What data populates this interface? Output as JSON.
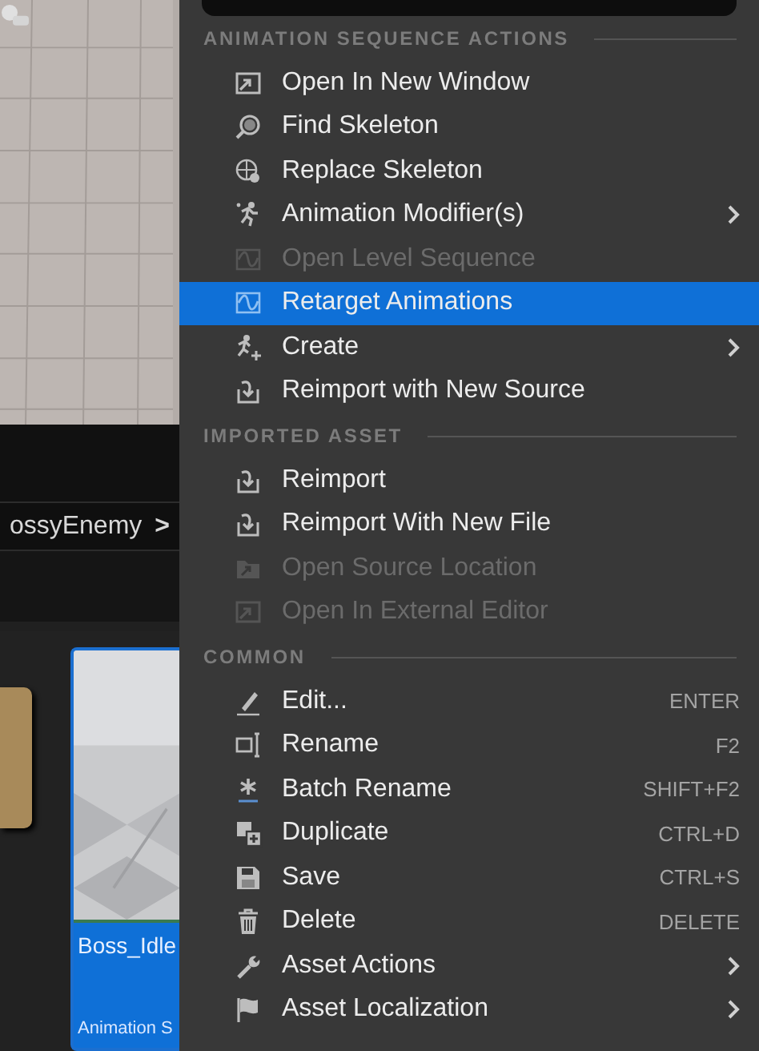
{
  "breadcrumb": {
    "label": "ossyEnemy",
    "chevron": ">"
  },
  "asset_tile": {
    "name": "Boss_Idle",
    "type": "Animation S",
    "selected": true
  },
  "menu": {
    "sections": [
      {
        "title": "ANIMATION SEQUENCE ACTIONS",
        "items": [
          {
            "label": "Open In New Window",
            "disabled": false,
            "selected": false,
            "submenu": false
          },
          {
            "label": "Find Skeleton",
            "disabled": false,
            "selected": false,
            "submenu": false
          },
          {
            "label": "Replace Skeleton",
            "disabled": false,
            "selected": false,
            "submenu": false
          },
          {
            "label": "Animation Modifier(s)",
            "disabled": false,
            "selected": false,
            "submenu": true
          },
          {
            "label": "Open Level Sequence",
            "disabled": true,
            "selected": false,
            "submenu": false
          },
          {
            "label": "Retarget Animations",
            "disabled": false,
            "selected": true,
            "submenu": false
          },
          {
            "label": "Create",
            "disabled": false,
            "selected": false,
            "submenu": true
          },
          {
            "label": "Reimport with New Source",
            "disabled": false,
            "selected": false,
            "submenu": false
          }
        ]
      },
      {
        "title": "IMPORTED ASSET",
        "items": [
          {
            "label": "Reimport",
            "disabled": false,
            "selected": false,
            "submenu": false
          },
          {
            "label": "Reimport With New File",
            "disabled": false,
            "selected": false,
            "submenu": false
          },
          {
            "label": "Open Source Location",
            "disabled": true,
            "selected": false,
            "submenu": false
          },
          {
            "label": "Open In External Editor",
            "disabled": true,
            "selected": false,
            "submenu": false
          }
        ]
      },
      {
        "title": "COMMON",
        "items": [
          {
            "label": "Edit...",
            "shortcut": "ENTER",
            "disabled": false,
            "selected": false,
            "submenu": false
          },
          {
            "label": "Rename",
            "shortcut": "F2",
            "disabled": false,
            "selected": false,
            "submenu": false
          },
          {
            "label": "Batch Rename",
            "shortcut": "SHIFT+F2",
            "disabled": false,
            "selected": false,
            "submenu": false
          },
          {
            "label": "Duplicate",
            "shortcut": "CTRL+D",
            "disabled": false,
            "selected": false,
            "submenu": false
          },
          {
            "label": "Save",
            "shortcut": "CTRL+S",
            "disabled": false,
            "selected": false,
            "submenu": false
          },
          {
            "label": "Delete",
            "shortcut": "DELETE",
            "disabled": false,
            "selected": false,
            "submenu": false
          },
          {
            "label": "Asset Actions",
            "disabled": false,
            "selected": false,
            "submenu": true
          },
          {
            "label": "Asset Localization",
            "disabled": false,
            "selected": false,
            "submenu": true
          }
        ]
      }
    ]
  }
}
